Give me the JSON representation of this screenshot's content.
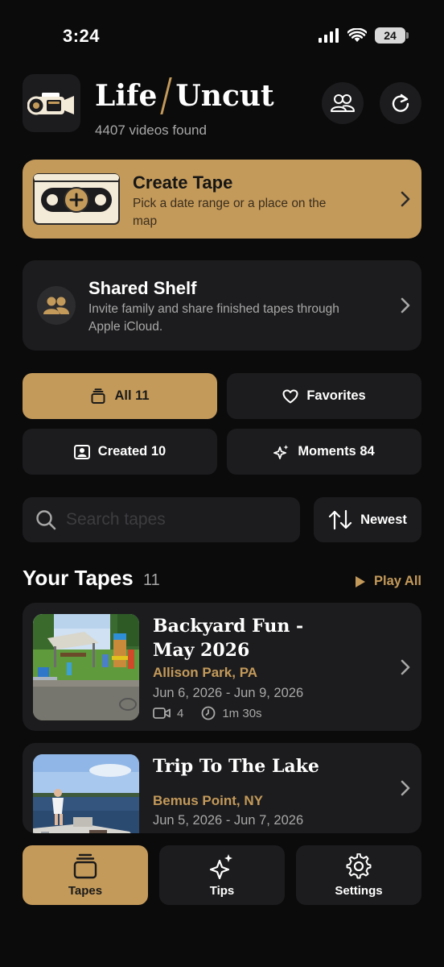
{
  "status": {
    "time": "3:24",
    "battery": "24"
  },
  "header": {
    "title_left": "Life",
    "title_right": "Uncut",
    "subtitle": "4407 videos found"
  },
  "create": {
    "title": "Create Tape",
    "description": "Pick a date range or a place on the map"
  },
  "shelf": {
    "title": "Shared Shelf",
    "description": "Invite family and share finished tapes through Apple iCloud."
  },
  "filters": {
    "all": "All 11",
    "favorites": "Favorites",
    "created": "Created 10",
    "moments": "Moments 84"
  },
  "search": {
    "placeholder": "Search tapes",
    "sort_label": "Newest"
  },
  "section": {
    "title": "Your Tapes",
    "count": "11",
    "play_all": "Play All"
  },
  "tapes": [
    {
      "name": "Backyard Fun - May 2026",
      "location": "Allison Park, PA",
      "dates": "Jun 6, 2026 - Jun 9, 2026",
      "clips": "4",
      "duration": "1m 30s"
    },
    {
      "name": "Trip To The Lake",
      "location": "Bemus Point, NY",
      "dates": "Jun 5, 2026 - Jun 7, 2026"
    }
  ],
  "tabs": {
    "tapes": "Tapes",
    "tips": "Tips",
    "settings": "Settings"
  },
  "colors": {
    "accent": "#c49a5a",
    "background": "#0b0b0c",
    "card": "#1c1c1e"
  }
}
